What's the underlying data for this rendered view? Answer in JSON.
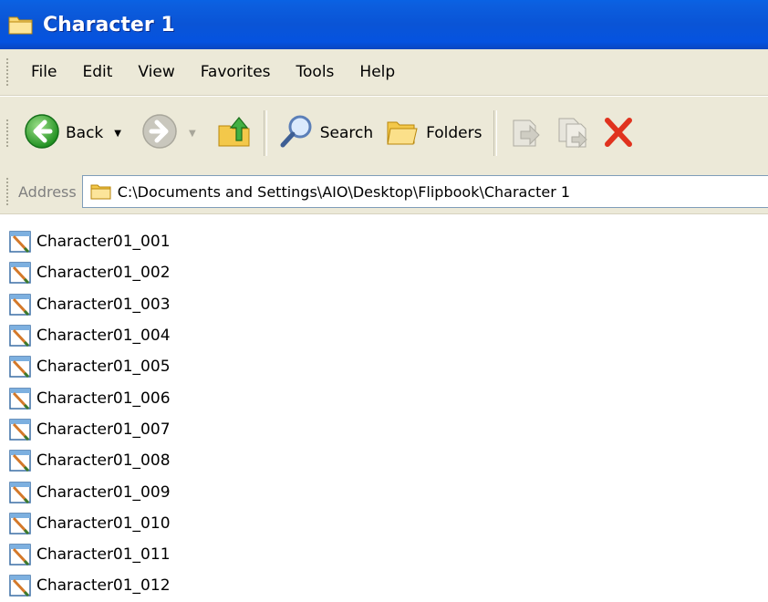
{
  "window": {
    "title": "Character 1"
  },
  "menu": [
    "File",
    "Edit",
    "View",
    "Favorites",
    "Tools",
    "Help"
  ],
  "toolbar": {
    "back_label": "Back",
    "search_label": "Search",
    "folders_label": "Folders"
  },
  "address": {
    "label": "Address",
    "path": "C:\\Documents and Settings\\AIO\\Desktop\\Flipbook\\Character 1"
  },
  "files": [
    "Character01_001",
    "Character01_002",
    "Character01_003",
    "Character01_004",
    "Character01_005",
    "Character01_006",
    "Character01_007",
    "Character01_008",
    "Character01_009",
    "Character01_010",
    "Character01_011",
    "Character01_012"
  ],
  "colors": {
    "titlebar": "#0a54d6",
    "chrome": "#ece9d8",
    "address_border": "#7f9db9"
  }
}
